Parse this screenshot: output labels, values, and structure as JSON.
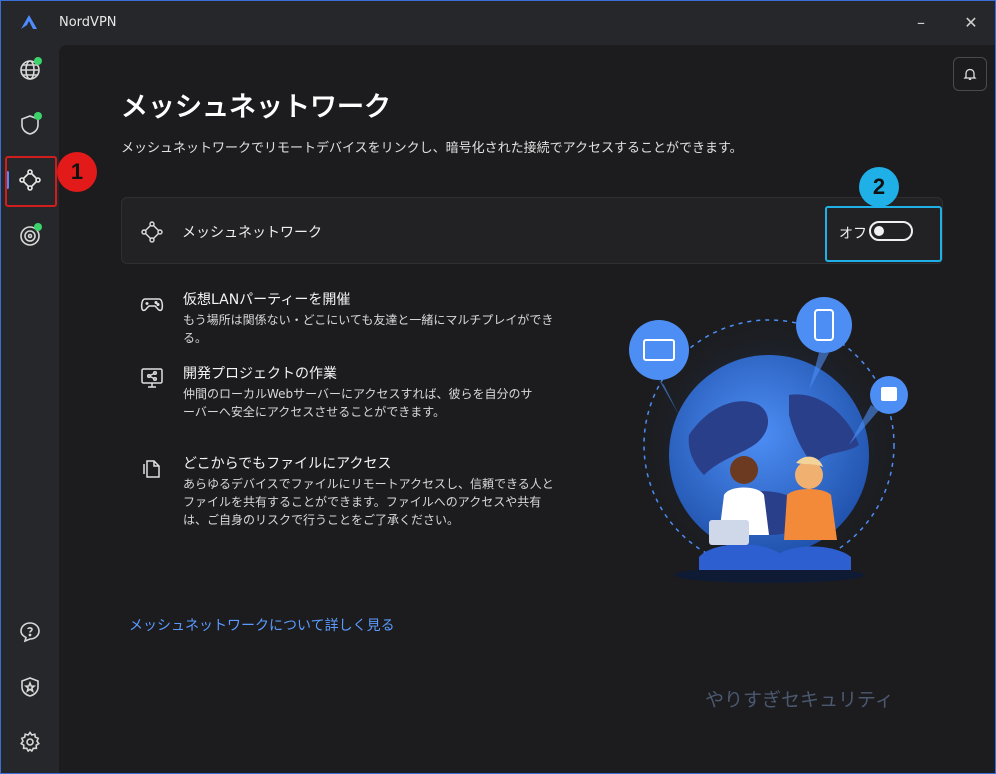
{
  "titlebar": {
    "app_title": "NordVPN",
    "minimize_glyph": "–",
    "close_glyph": "✕"
  },
  "sidebar": {
    "items": [
      {
        "name": "globe-icon",
        "status_dot": true
      },
      {
        "name": "shield-icon",
        "status_dot": true
      },
      {
        "name": "meshnet-icon",
        "active": true
      },
      {
        "name": "target-icon",
        "status_dot": true
      },
      {
        "name": "help-icon"
      },
      {
        "name": "shield-star-icon"
      },
      {
        "name": "gear-icon"
      }
    ]
  },
  "annotations": {
    "badge_1": "1",
    "badge_2": "2"
  },
  "main": {
    "title": "メッシュネットワーク",
    "description": "メッシュネットワークでリモートデバイスをリンクし、暗号化された接続でアクセスすることができます。",
    "mesh_card": {
      "label": "メッシュネットワーク",
      "toggle_label": "オフ",
      "toggle_state": "off"
    },
    "features": [
      {
        "icon": "gamepad-icon",
        "title": "仮想LANパーティーを開催",
        "desc": "もう場所は関係ない・どこにいても友達と一緒にマルチプレイができる。"
      },
      {
        "icon": "monitor-share-icon",
        "title": "開発プロジェクトの作業",
        "desc": "仲間のローカルWebサーバーにアクセスすれば、彼らを自分のサーバーへ安全にアクセスさせることができます。"
      },
      {
        "icon": "files-icon",
        "title": "どこからでもファイルにアクセス",
        "desc": "あらゆるデバイスでファイルにリモートアクセスし、信頼できる人とファイルを共有することができます。ファイルへのアクセスや共有は、ご自身のリスクで行うことをご了承ください。"
      }
    ],
    "learn_more": "メッシュネットワークについて詳しく見る",
    "watermark": "やりすぎセキュリティ"
  },
  "colors": {
    "accent_blue": "#5b9bff",
    "status_green": "#3bd46a",
    "annotation_red": "#e21a1a",
    "annotation_cyan": "#1fb0e8"
  }
}
